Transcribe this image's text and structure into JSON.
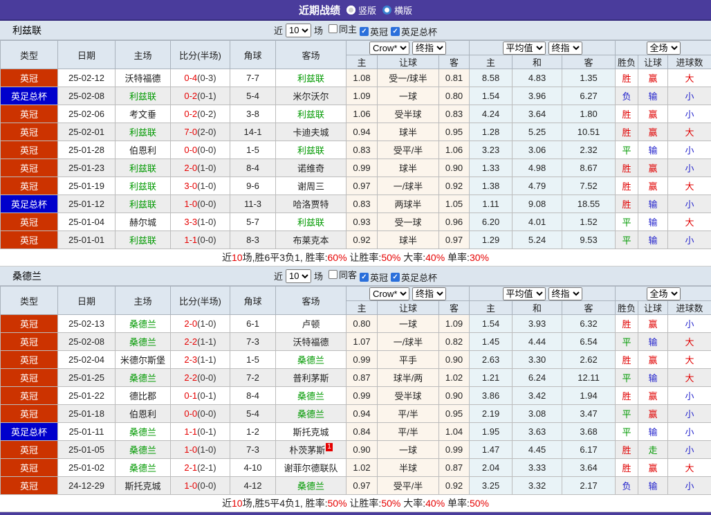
{
  "topbar": {
    "title": "近期战绩",
    "radios": [
      {
        "label": "竖版",
        "selected": true
      },
      {
        "label": "横版",
        "selected": false
      }
    ]
  },
  "badge_colors": {
    "英冠": "#cc3300",
    "英足总杯": "#0000cc"
  },
  "result_colors": {
    "胜": "#e00000",
    "赢": "#e00000",
    "大": "#e00000",
    "负": "#2222cc",
    "输": "#2222cc",
    "小": "#2222cc",
    "平": "#009900",
    "走": "#009900"
  },
  "focus_team_color": "#009900",
  "sections": [
    {
      "team": "利兹联",
      "filter": {
        "near_label": "近",
        "count": "10",
        "games_label": "场",
        "checkboxes": [
          {
            "label": "同主",
            "checked": false
          },
          {
            "label": "英冠",
            "checked": true
          },
          {
            "label": "英足总杯",
            "checked": true
          }
        ]
      },
      "header": {
        "left": [
          "类型",
          "日期",
          "主场",
          "比分(半场)",
          "角球",
          "客场"
        ],
        "selects": [
          "Crow*",
          "终指",
          "平均值",
          "终指",
          "全场"
        ],
        "sub": [
          "主",
          "让球",
          "客",
          "主",
          "和",
          "客",
          "胜负",
          "让球",
          "进球数"
        ]
      },
      "rows": [
        {
          "type": "英冠",
          "date": "25-02-12",
          "home": "沃特福德",
          "home_focus": false,
          "score": "0-4",
          "half": "(0-3)",
          "corner": "7-7",
          "away": "利兹联",
          "away_focus": true,
          "odds_home": "1.08",
          "handicap": "受一/球半",
          "odds_away": "0.81",
          "avg_home": "8.58",
          "avg_draw": "4.83",
          "avg_away": "1.35",
          "res_wdl": "胜",
          "res_handicap": "赢",
          "res_goals": "大"
        },
        {
          "type": "英足总杯",
          "date": "25-02-08",
          "home": "利兹联",
          "home_focus": true,
          "score": "0-2",
          "half": "(0-1)",
          "corner": "5-4",
          "away": "米尔沃尔",
          "away_focus": false,
          "odds_home": "1.09",
          "handicap": "一球",
          "odds_away": "0.80",
          "avg_home": "1.54",
          "avg_draw": "3.96",
          "avg_away": "6.27",
          "res_wdl": "负",
          "res_handicap": "输",
          "res_goals": "小"
        },
        {
          "type": "英冠",
          "date": "25-02-06",
          "home": "考文垂",
          "home_focus": false,
          "score": "0-2",
          "half": "(0-2)",
          "corner": "3-8",
          "away": "利兹联",
          "away_focus": true,
          "odds_home": "1.06",
          "handicap": "受半球",
          "odds_away": "0.83",
          "avg_home": "4.24",
          "avg_draw": "3.64",
          "avg_away": "1.80",
          "res_wdl": "胜",
          "res_handicap": "赢",
          "res_goals": "小"
        },
        {
          "type": "英冠",
          "date": "25-02-01",
          "home": "利兹联",
          "home_focus": true,
          "score": "7-0",
          "half": "(2-0)",
          "corner": "14-1",
          "away": "卡迪夫城",
          "away_focus": false,
          "odds_home": "0.94",
          "handicap": "球半",
          "odds_away": "0.95",
          "avg_home": "1.28",
          "avg_draw": "5.25",
          "avg_away": "10.51",
          "res_wdl": "胜",
          "res_handicap": "赢",
          "res_goals": "大"
        },
        {
          "type": "英冠",
          "date": "25-01-28",
          "home": "伯恩利",
          "home_focus": false,
          "score": "0-0",
          "half": "(0-0)",
          "corner": "1-5",
          "away": "利兹联",
          "away_focus": true,
          "odds_home": "0.83",
          "handicap": "受平/半",
          "odds_away": "1.06",
          "avg_home": "3.23",
          "avg_draw": "3.06",
          "avg_away": "2.32",
          "res_wdl": "平",
          "res_handicap": "输",
          "res_goals": "小"
        },
        {
          "type": "英冠",
          "date": "25-01-23",
          "home": "利兹联",
          "home_focus": true,
          "score": "2-0",
          "half": "(1-0)",
          "corner": "8-4",
          "away": "诺维奇",
          "away_focus": false,
          "odds_home": "0.99",
          "handicap": "球半",
          "odds_away": "0.90",
          "avg_home": "1.33",
          "avg_draw": "4.98",
          "avg_away": "8.67",
          "res_wdl": "胜",
          "res_handicap": "赢",
          "res_goals": "小"
        },
        {
          "type": "英冠",
          "date": "25-01-19",
          "home": "利兹联",
          "home_focus": true,
          "score": "3-0",
          "half": "(1-0)",
          "corner": "9-6",
          "away": "谢周三",
          "away_focus": false,
          "odds_home": "0.97",
          "handicap": "一/球半",
          "odds_away": "0.92",
          "avg_home": "1.38",
          "avg_draw": "4.79",
          "avg_away": "7.52",
          "res_wdl": "胜",
          "res_handicap": "赢",
          "res_goals": "大"
        },
        {
          "type": "英足总杯",
          "date": "25-01-12",
          "home": "利兹联",
          "home_focus": true,
          "score": "1-0",
          "half": "(0-0)",
          "corner": "11-3",
          "away": "哈洛贾特",
          "away_focus": false,
          "odds_home": "0.83",
          "handicap": "两球半",
          "odds_away": "1.05",
          "avg_home": "1.11",
          "avg_draw": "9.08",
          "avg_away": "18.55",
          "res_wdl": "胜",
          "res_handicap": "输",
          "res_goals": "小"
        },
        {
          "type": "英冠",
          "date": "25-01-04",
          "home": "赫尔城",
          "home_focus": false,
          "score": "3-3",
          "half": "(1-0)",
          "corner": "5-7",
          "away": "利兹联",
          "away_focus": true,
          "odds_home": "0.93",
          "handicap": "受一球",
          "odds_away": "0.96",
          "avg_home": "6.20",
          "avg_draw": "4.01",
          "avg_away": "1.52",
          "res_wdl": "平",
          "res_handicap": "输",
          "res_goals": "大"
        },
        {
          "type": "英冠",
          "date": "25-01-01",
          "home": "利兹联",
          "home_focus": true,
          "score": "1-1",
          "half": "(0-0)",
          "corner": "8-3",
          "away": "布莱克本",
          "away_focus": false,
          "odds_home": "0.92",
          "handicap": "球半",
          "odds_away": "0.97",
          "avg_home": "1.29",
          "avg_draw": "5.24",
          "avg_away": "9.53",
          "res_wdl": "平",
          "res_handicap": "输",
          "res_goals": "小"
        }
      ],
      "summary": [
        {
          "text": "近",
          "red": false
        },
        {
          "text": "10",
          "red": true
        },
        {
          "text": "场,胜6平3负1, 胜率:",
          "red": false
        },
        {
          "text": "60%",
          "red": true
        },
        {
          "text": " 让胜率:",
          "red": false
        },
        {
          "text": "50%",
          "red": true
        },
        {
          "text": " 大率:",
          "red": false
        },
        {
          "text": "40%",
          "red": true
        },
        {
          "text": " 单率:",
          "red": false
        },
        {
          "text": "30%",
          "red": true
        }
      ]
    },
    {
      "team": "桑德兰",
      "filter": {
        "near_label": "近",
        "count": "10",
        "games_label": "场",
        "checkboxes": [
          {
            "label": "同客",
            "checked": false
          },
          {
            "label": "英冠",
            "checked": true
          },
          {
            "label": "英足总杯",
            "checked": true
          }
        ]
      },
      "header": {
        "left": [
          "类型",
          "日期",
          "主场",
          "比分(半场)",
          "角球",
          "客场"
        ],
        "selects": [
          "Crow*",
          "终指",
          "平均值",
          "终指",
          "全场"
        ],
        "sub": [
          "主",
          "让球",
          "客",
          "主",
          "和",
          "客",
          "胜负",
          "让球",
          "进球数"
        ]
      },
      "rows": [
        {
          "type": "英冠",
          "date": "25-02-13",
          "home": "桑德兰",
          "home_focus": true,
          "score": "2-0",
          "half": "(1-0)",
          "corner": "6-1",
          "away": "卢顿",
          "away_focus": false,
          "odds_home": "0.80",
          "handicap": "一球",
          "odds_away": "1.09",
          "avg_home": "1.54",
          "avg_draw": "3.93",
          "avg_away": "6.32",
          "res_wdl": "胜",
          "res_handicap": "赢",
          "res_goals": "小"
        },
        {
          "type": "英冠",
          "date": "25-02-08",
          "home": "桑德兰",
          "home_focus": true,
          "score": "2-2",
          "half": "(1-1)",
          "corner": "7-3",
          "away": "沃特福德",
          "away_focus": false,
          "odds_home": "1.07",
          "handicap": "一/球半",
          "odds_away": "0.82",
          "avg_home": "1.45",
          "avg_draw": "4.44",
          "avg_away": "6.54",
          "res_wdl": "平",
          "res_handicap": "输",
          "res_goals": "大"
        },
        {
          "type": "英冠",
          "date": "25-02-04",
          "home": "米德尔斯堡",
          "home_focus": false,
          "score": "2-3",
          "half": "(1-1)",
          "corner": "1-5",
          "away": "桑德兰",
          "away_focus": true,
          "odds_home": "0.99",
          "handicap": "平手",
          "odds_away": "0.90",
          "avg_home": "2.63",
          "avg_draw": "3.30",
          "avg_away": "2.62",
          "res_wdl": "胜",
          "res_handicap": "赢",
          "res_goals": "大"
        },
        {
          "type": "英冠",
          "date": "25-01-25",
          "home": "桑德兰",
          "home_focus": true,
          "score": "2-2",
          "half": "(0-0)",
          "corner": "7-2",
          "away": "普利茅斯",
          "away_focus": false,
          "odds_home": "0.87",
          "handicap": "球半/两",
          "odds_away": "1.02",
          "avg_home": "1.21",
          "avg_draw": "6.24",
          "avg_away": "12.11",
          "res_wdl": "平",
          "res_handicap": "输",
          "res_goals": "大"
        },
        {
          "type": "英冠",
          "date": "25-01-22",
          "home": "德比郡",
          "home_focus": false,
          "score": "0-1",
          "half": "(0-1)",
          "corner": "8-4",
          "away": "桑德兰",
          "away_focus": true,
          "odds_home": "0.99",
          "handicap": "受半球",
          "odds_away": "0.90",
          "avg_home": "3.86",
          "avg_draw": "3.42",
          "avg_away": "1.94",
          "res_wdl": "胜",
          "res_handicap": "赢",
          "res_goals": "小"
        },
        {
          "type": "英冠",
          "date": "25-01-18",
          "home": "伯恩利",
          "home_focus": false,
          "score": "0-0",
          "half": "(0-0)",
          "corner": "5-4",
          "away": "桑德兰",
          "away_focus": true,
          "odds_home": "0.94",
          "handicap": "平/半",
          "odds_away": "0.95",
          "avg_home": "2.19",
          "avg_draw": "3.08",
          "avg_away": "3.47",
          "res_wdl": "平",
          "res_handicap": "赢",
          "res_goals": "小"
        },
        {
          "type": "英足总杯",
          "date": "25-01-11",
          "home": "桑德兰",
          "home_focus": true,
          "score": "1-1",
          "half": "(0-1)",
          "corner": "1-2",
          "away": "斯托克城",
          "away_focus": false,
          "odds_home": "0.84",
          "handicap": "平/半",
          "odds_away": "1.04",
          "avg_home": "1.95",
          "avg_draw": "3.63",
          "avg_away": "3.68",
          "res_wdl": "平",
          "res_handicap": "输",
          "res_goals": "小"
        },
        {
          "type": "英冠",
          "date": "25-01-05",
          "home": "桑德兰",
          "home_focus": true,
          "score": "1-0",
          "half": "(1-0)",
          "corner": "7-3",
          "away": "朴茨茅斯",
          "away_focus": false,
          "away_badge": "1",
          "odds_home": "0.90",
          "handicap": "一球",
          "odds_away": "0.99",
          "avg_home": "1.47",
          "avg_draw": "4.45",
          "avg_away": "6.17",
          "res_wdl": "胜",
          "res_handicap": "走",
          "res_goals": "小"
        },
        {
          "type": "英冠",
          "date": "25-01-02",
          "home": "桑德兰",
          "home_focus": true,
          "score": "2-1",
          "half": "(2-1)",
          "corner": "4-10",
          "away": "谢菲尔德联队",
          "away_focus": false,
          "odds_home": "1.02",
          "handicap": "半球",
          "odds_away": "0.87",
          "avg_home": "2.04",
          "avg_draw": "3.33",
          "avg_away": "3.64",
          "res_wdl": "胜",
          "res_handicap": "赢",
          "res_goals": "大"
        },
        {
          "type": "英冠",
          "date": "24-12-29",
          "home": "斯托克城",
          "home_focus": false,
          "score": "1-0",
          "half": "(0-0)",
          "corner": "4-12",
          "away": "桑德兰",
          "away_focus": true,
          "odds_home": "0.97",
          "handicap": "受平/半",
          "odds_away": "0.92",
          "avg_home": "3.25",
          "avg_draw": "3.32",
          "avg_away": "2.17",
          "res_wdl": "负",
          "res_handicap": "输",
          "res_goals": "小"
        }
      ],
      "summary": [
        {
          "text": "近",
          "red": false
        },
        {
          "text": "10",
          "red": true
        },
        {
          "text": "场,胜5平4负1, 胜率:",
          "red": false
        },
        {
          "text": "50%",
          "red": true
        },
        {
          "text": " 让胜率:",
          "red": false
        },
        {
          "text": "50%",
          "red": true
        },
        {
          "text": " 大率:",
          "red": false
        },
        {
          "text": "40%",
          "red": true
        },
        {
          "text": " 单率:",
          "red": false
        },
        {
          "text": "50%",
          "red": true
        }
      ]
    }
  ]
}
